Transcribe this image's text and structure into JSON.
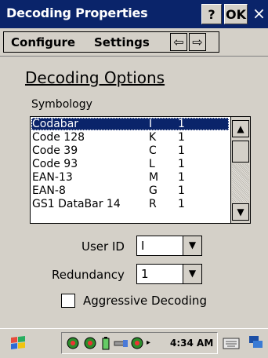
{
  "window": {
    "title": "Decoding Properties",
    "help_label": "?",
    "ok_label": "OK",
    "close_label": "×"
  },
  "menu": {
    "configure": "Configure",
    "settings": "Settings",
    "back_arrow": "⇦",
    "forward_arrow": "⇨"
  },
  "section": {
    "heading": "Decoding Options",
    "symbology_label": "Symbology"
  },
  "symbology": {
    "rows": [
      {
        "name": "Codabar",
        "id": "I",
        "redundancy": "1",
        "selected": true
      },
      {
        "name": "Code 128",
        "id": "K",
        "redundancy": "1"
      },
      {
        "name": "Code 39",
        "id": "C",
        "redundancy": "1"
      },
      {
        "name": "Code 93",
        "id": "L",
        "redundancy": "1"
      },
      {
        "name": "EAN-13",
        "id": "M",
        "redundancy": "1"
      },
      {
        "name": "EAN-8",
        "id": "G",
        "redundancy": "1"
      },
      {
        "name": "GS1 DataBar 14",
        "id": "R",
        "redundancy": "1"
      }
    ]
  },
  "form": {
    "user_id_label": "User ID",
    "user_id_value": "I",
    "redundancy_label": "Redundancy",
    "redundancy_value": "1",
    "aggressive_label": "Aggressive Decoding",
    "aggressive_checked": false
  },
  "taskbar": {
    "time": "4:34 AM"
  },
  "colors": {
    "titlebar": "#0a246a",
    "window_bg": "#d4d0c8",
    "selection": "#0a246a"
  }
}
